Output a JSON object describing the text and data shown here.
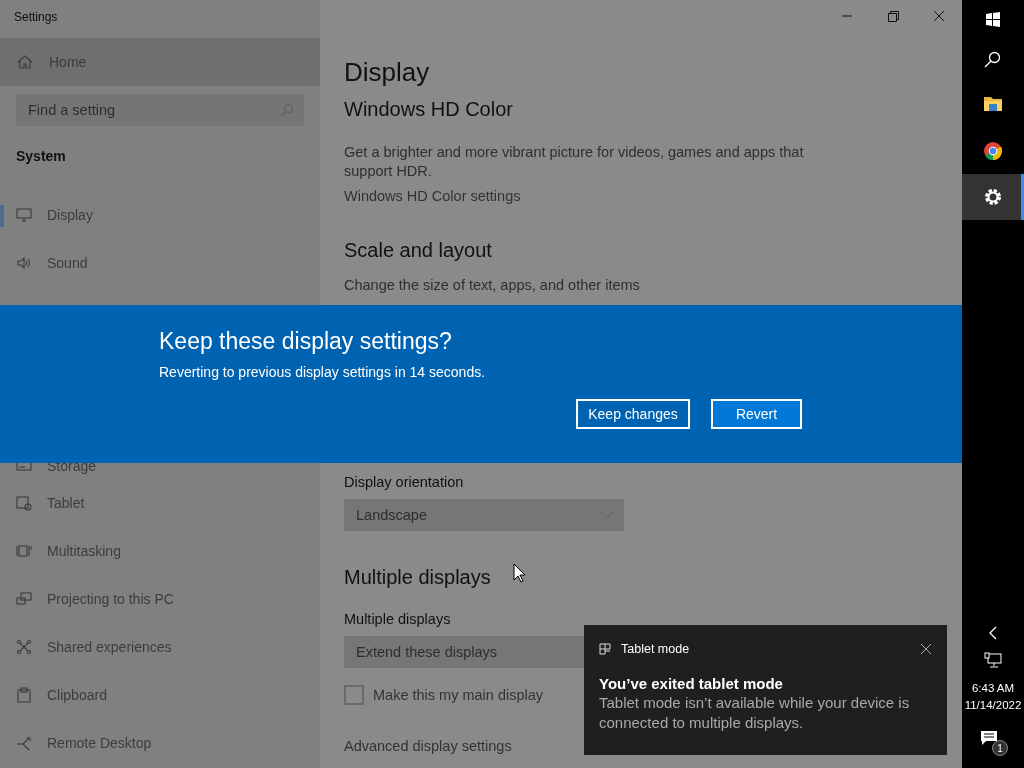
{
  "window": {
    "title": "Settings"
  },
  "sidebar": {
    "home": "Home",
    "search": {
      "placeholder": "Find a setting"
    },
    "section": "System",
    "items": [
      {
        "label": "Display",
        "kind": "display",
        "selected": true
      },
      {
        "label": "Sound",
        "kind": "sound",
        "selected": false
      },
      {
        "label": "Storage",
        "kind": "storage",
        "selected": false
      },
      {
        "label": "Tablet",
        "kind": "tablet",
        "selected": false
      },
      {
        "label": "Multitasking",
        "kind": "multitasking",
        "selected": false
      },
      {
        "label": "Projecting to this PC",
        "kind": "projecting",
        "selected": false
      },
      {
        "label": "Shared experiences",
        "kind": "shared",
        "selected": false
      },
      {
        "label": "Clipboard",
        "kind": "clipboard",
        "selected": false
      },
      {
        "label": "Remote Desktop",
        "kind": "remote",
        "selected": false
      }
    ]
  },
  "content": {
    "title": "Display",
    "sections": [
      {
        "heading": "Windows HD Color",
        "items": [
          {
            "kind": "text",
            "text": "Get a brighter and more vibrant picture for videos, games and apps that support HDR."
          },
          {
            "kind": "link",
            "text": "Windows HD Color settings"
          }
        ]
      },
      {
        "heading": "Scale and layout",
        "items": [
          {
            "kind": "caption",
            "text": "Change the size of text, apps, and other items"
          },
          {
            "kind": "label",
            "text": "Display orientation"
          },
          {
            "kind": "dropdown",
            "value": "Landscape"
          }
        ]
      },
      {
        "heading": "Multiple displays",
        "items": [
          {
            "kind": "label",
            "text": "Multiple displays"
          },
          {
            "kind": "dropdown",
            "value": "Extend these displays"
          },
          {
            "kind": "checkbox",
            "text": "Make this my main display",
            "checked": false
          },
          {
            "kind": "link",
            "text": "Advanced display settings"
          }
        ]
      }
    ]
  },
  "dialog": {
    "title": "Keep these display settings?",
    "message": "Reverting to previous display settings in 14 seconds.",
    "buttons": [
      {
        "label": "Keep changes",
        "default": false
      },
      {
        "label": "Revert",
        "default": true
      }
    ]
  },
  "toast": {
    "app": "Tablet mode",
    "title": "You’ve exited tablet mode",
    "body": "Tablet mode isn’t available while your device is connected to multiple displays."
  },
  "taskbar": {
    "apps": [
      {
        "kind": "start",
        "selected": false
      },
      {
        "kind": "search",
        "selected": false
      },
      {
        "kind": "folder",
        "selected": false
      },
      {
        "kind": "browser",
        "selected": false
      },
      {
        "kind": "settings",
        "selected": true
      }
    ],
    "time": "6:43 AM",
    "date": "11/14/2022",
    "notifications": "1"
  }
}
